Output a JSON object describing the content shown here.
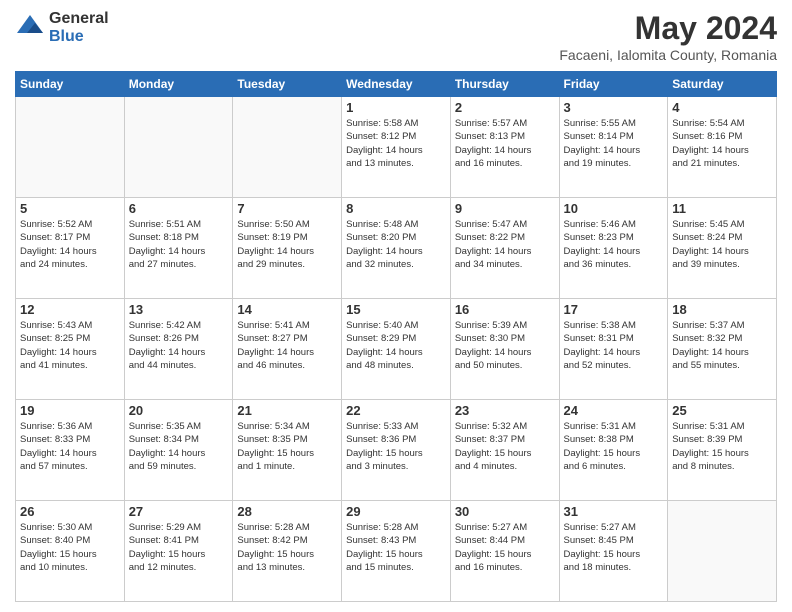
{
  "header": {
    "logo_general": "General",
    "logo_blue": "Blue",
    "title": "May 2024",
    "subtitle": "Facaeni, Ialomita County, Romania"
  },
  "days_of_week": [
    "Sunday",
    "Monday",
    "Tuesday",
    "Wednesday",
    "Thursday",
    "Friday",
    "Saturday"
  ],
  "weeks": [
    [
      {
        "day": "",
        "info": ""
      },
      {
        "day": "",
        "info": ""
      },
      {
        "day": "",
        "info": ""
      },
      {
        "day": "1",
        "info": "Sunrise: 5:58 AM\nSunset: 8:12 PM\nDaylight: 14 hours\nand 13 minutes."
      },
      {
        "day": "2",
        "info": "Sunrise: 5:57 AM\nSunset: 8:13 PM\nDaylight: 14 hours\nand 16 minutes."
      },
      {
        "day": "3",
        "info": "Sunrise: 5:55 AM\nSunset: 8:14 PM\nDaylight: 14 hours\nand 19 minutes."
      },
      {
        "day": "4",
        "info": "Sunrise: 5:54 AM\nSunset: 8:16 PM\nDaylight: 14 hours\nand 21 minutes."
      }
    ],
    [
      {
        "day": "5",
        "info": "Sunrise: 5:52 AM\nSunset: 8:17 PM\nDaylight: 14 hours\nand 24 minutes."
      },
      {
        "day": "6",
        "info": "Sunrise: 5:51 AM\nSunset: 8:18 PM\nDaylight: 14 hours\nand 27 minutes."
      },
      {
        "day": "7",
        "info": "Sunrise: 5:50 AM\nSunset: 8:19 PM\nDaylight: 14 hours\nand 29 minutes."
      },
      {
        "day": "8",
        "info": "Sunrise: 5:48 AM\nSunset: 8:20 PM\nDaylight: 14 hours\nand 32 minutes."
      },
      {
        "day": "9",
        "info": "Sunrise: 5:47 AM\nSunset: 8:22 PM\nDaylight: 14 hours\nand 34 minutes."
      },
      {
        "day": "10",
        "info": "Sunrise: 5:46 AM\nSunset: 8:23 PM\nDaylight: 14 hours\nand 36 minutes."
      },
      {
        "day": "11",
        "info": "Sunrise: 5:45 AM\nSunset: 8:24 PM\nDaylight: 14 hours\nand 39 minutes."
      }
    ],
    [
      {
        "day": "12",
        "info": "Sunrise: 5:43 AM\nSunset: 8:25 PM\nDaylight: 14 hours\nand 41 minutes."
      },
      {
        "day": "13",
        "info": "Sunrise: 5:42 AM\nSunset: 8:26 PM\nDaylight: 14 hours\nand 44 minutes."
      },
      {
        "day": "14",
        "info": "Sunrise: 5:41 AM\nSunset: 8:27 PM\nDaylight: 14 hours\nand 46 minutes."
      },
      {
        "day": "15",
        "info": "Sunrise: 5:40 AM\nSunset: 8:29 PM\nDaylight: 14 hours\nand 48 minutes."
      },
      {
        "day": "16",
        "info": "Sunrise: 5:39 AM\nSunset: 8:30 PM\nDaylight: 14 hours\nand 50 minutes."
      },
      {
        "day": "17",
        "info": "Sunrise: 5:38 AM\nSunset: 8:31 PM\nDaylight: 14 hours\nand 52 minutes."
      },
      {
        "day": "18",
        "info": "Sunrise: 5:37 AM\nSunset: 8:32 PM\nDaylight: 14 hours\nand 55 minutes."
      }
    ],
    [
      {
        "day": "19",
        "info": "Sunrise: 5:36 AM\nSunset: 8:33 PM\nDaylight: 14 hours\nand 57 minutes."
      },
      {
        "day": "20",
        "info": "Sunrise: 5:35 AM\nSunset: 8:34 PM\nDaylight: 14 hours\nand 59 minutes."
      },
      {
        "day": "21",
        "info": "Sunrise: 5:34 AM\nSunset: 8:35 PM\nDaylight: 15 hours\nand 1 minute."
      },
      {
        "day": "22",
        "info": "Sunrise: 5:33 AM\nSunset: 8:36 PM\nDaylight: 15 hours\nand 3 minutes."
      },
      {
        "day": "23",
        "info": "Sunrise: 5:32 AM\nSunset: 8:37 PM\nDaylight: 15 hours\nand 4 minutes."
      },
      {
        "day": "24",
        "info": "Sunrise: 5:31 AM\nSunset: 8:38 PM\nDaylight: 15 hours\nand 6 minutes."
      },
      {
        "day": "25",
        "info": "Sunrise: 5:31 AM\nSunset: 8:39 PM\nDaylight: 15 hours\nand 8 minutes."
      }
    ],
    [
      {
        "day": "26",
        "info": "Sunrise: 5:30 AM\nSunset: 8:40 PM\nDaylight: 15 hours\nand 10 minutes."
      },
      {
        "day": "27",
        "info": "Sunrise: 5:29 AM\nSunset: 8:41 PM\nDaylight: 15 hours\nand 12 minutes."
      },
      {
        "day": "28",
        "info": "Sunrise: 5:28 AM\nSunset: 8:42 PM\nDaylight: 15 hours\nand 13 minutes."
      },
      {
        "day": "29",
        "info": "Sunrise: 5:28 AM\nSunset: 8:43 PM\nDaylight: 15 hours\nand 15 minutes."
      },
      {
        "day": "30",
        "info": "Sunrise: 5:27 AM\nSunset: 8:44 PM\nDaylight: 15 hours\nand 16 minutes."
      },
      {
        "day": "31",
        "info": "Sunrise: 5:27 AM\nSunset: 8:45 PM\nDaylight: 15 hours\nand 18 minutes."
      },
      {
        "day": "",
        "info": ""
      }
    ]
  ]
}
